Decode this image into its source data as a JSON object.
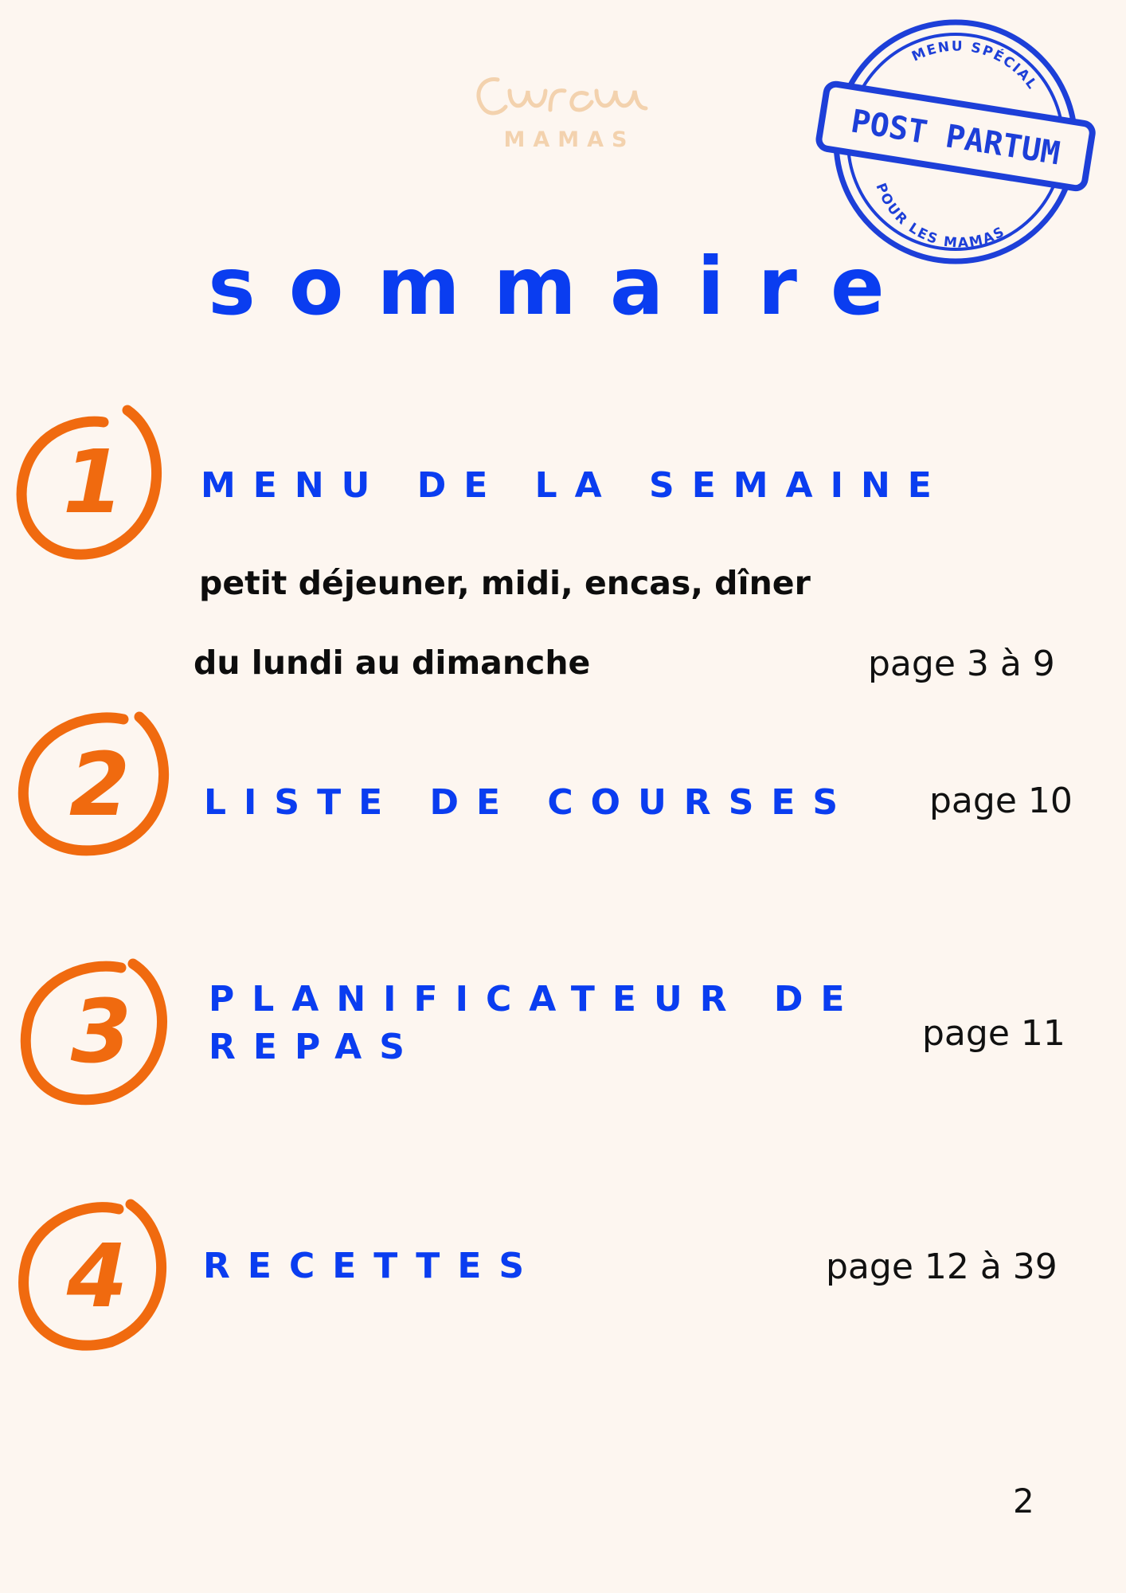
{
  "logo": {
    "script_text": "Cuucu",
    "subtitle": "MAMAS"
  },
  "stamp": {
    "top_text": "MENU SPÉCIAL",
    "main_text": "POST PARTUM",
    "bottom_text": "POUR LES MAMAS"
  },
  "title": "sommaire",
  "sections": [
    {
      "number": "1",
      "heading": "MENU DE LA SEMAINE",
      "lines": [
        "petit déjeuner, midi, encas, dîner",
        "du lundi au dimanche"
      ],
      "page": "page 3 à 9"
    },
    {
      "number": "2",
      "heading": "LISTE DE COURSES",
      "page": "page 10"
    },
    {
      "number": "3",
      "heading": "PLANIFICATEUR DE REPAS",
      "page": "page 11"
    },
    {
      "number": "4",
      "heading": "RECETTES",
      "page": "page 12 à 39"
    }
  ],
  "page_number": "2",
  "colors": {
    "accent_blue": "#0a3df0",
    "accent_orange": "#f06a0f",
    "logo_beige": "#f3d2ae",
    "background": "#fdf6f0"
  }
}
